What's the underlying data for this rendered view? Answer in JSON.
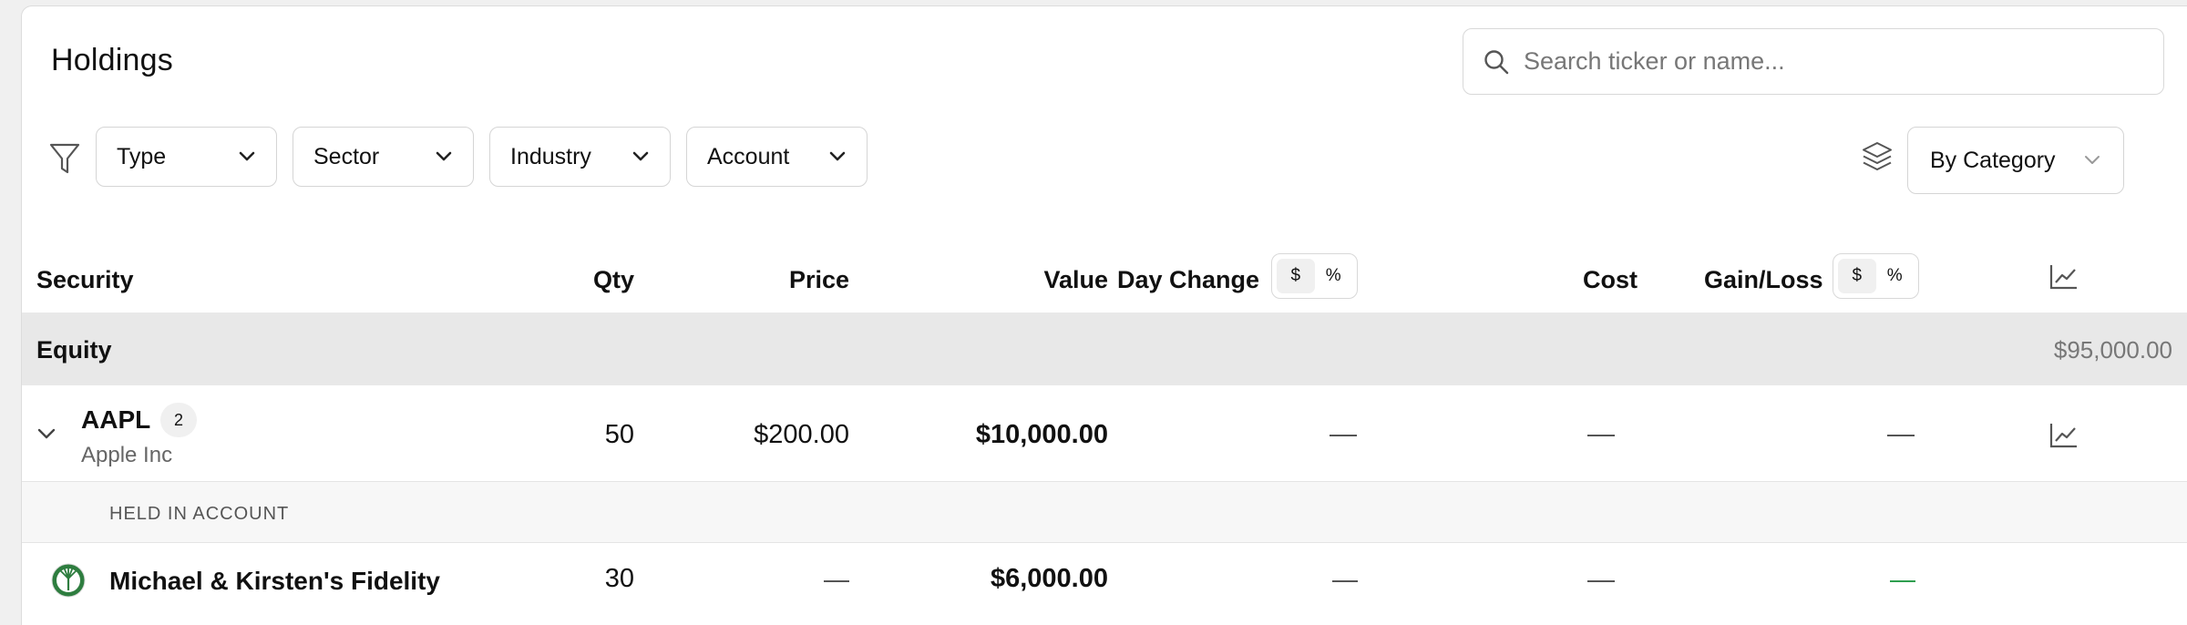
{
  "page": {
    "title": "Holdings"
  },
  "search": {
    "placeholder": "Search ticker or name...",
    "icon": "search-icon"
  },
  "filters": {
    "icon": "filter-icon",
    "dropdowns": [
      {
        "label": "Type"
      },
      {
        "label": "Sector"
      },
      {
        "label": "Industry"
      },
      {
        "label": "Account"
      }
    ]
  },
  "grouping": {
    "icon": "layers-icon",
    "selected": "By Category"
  },
  "table": {
    "columns": {
      "security": "Security",
      "qty": "Qty",
      "price": "Price",
      "value": "Value",
      "day_change": "Day Change",
      "cost": "Cost",
      "gain_loss": "Gain/Loss"
    },
    "toggles": {
      "day_change": {
        "dollar": "$",
        "percent": "%",
        "active": "$"
      },
      "gain_loss": {
        "dollar": "$",
        "percent": "%",
        "active": "$"
      }
    },
    "chart_column_icon": "chart-line-icon",
    "groups": [
      {
        "label": "Equity",
        "total": "$95,000.00",
        "rows": [
          {
            "ticker": "AAPL",
            "lot_count": "2",
            "name": "Apple Inc",
            "qty": "50",
            "price": "$200.00",
            "value": "$10,000.00",
            "day_change": "—",
            "cost": "—",
            "gain_loss": "—",
            "expanded": true,
            "held_in_label": "HELD IN ACCOUNT",
            "accounts": [
              {
                "name": "Michael & Kirsten's Fidelity",
                "qty": "30",
                "price": "—",
                "value": "$6,000.00",
                "day_change": "—",
                "cost": "—",
                "gain_loss": "—"
              }
            ]
          }
        ]
      }
    ]
  },
  "colors": {
    "accent_green": "#2e9e4f",
    "group_bg": "#e8e8e8",
    "muted_text": "#777777"
  }
}
